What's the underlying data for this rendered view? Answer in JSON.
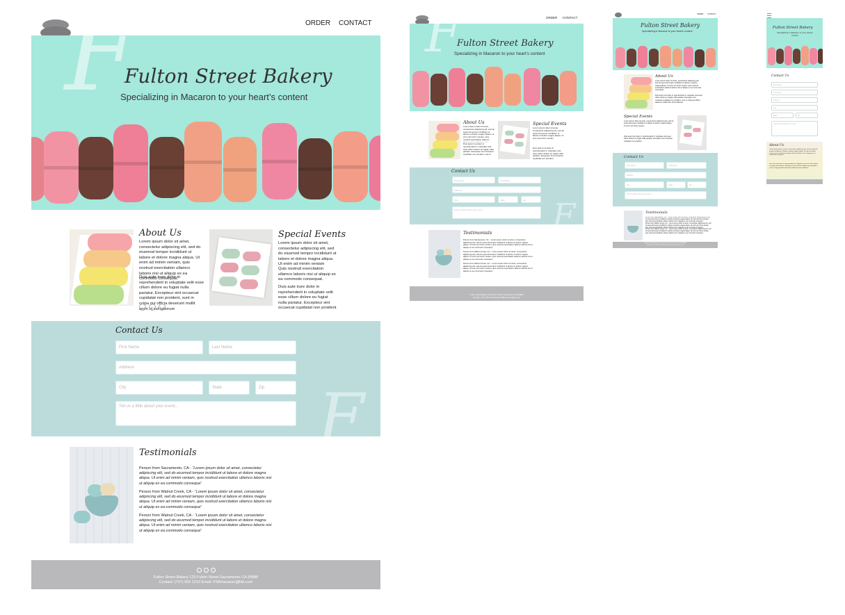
{
  "nav": {
    "order": "ORDER",
    "contact": "CONTACT"
  },
  "hero": {
    "title": "Fulton Street Bakery",
    "subtitle": "Specializing in Macaron to your heart’s content",
    "watermark": "F"
  },
  "about": {
    "heading": "About Us",
    "p1": "Lorem ipsum dolor sit amet, consectetur adipiscing elit, sed do eiusmod tempor incididunt ut labore et dolore magna aliqua. Ut enim ad minim veniam, quis nostrud exercitation ullamco laboris nisi ut aliquip ex ea commodo consequat.",
    "p2": "Duis aute irure dolor in reprehenderit in voluptate velit esse cillum dolore eu fugiat nulla pariatur. Excepteur sint occaecat cupidatat non proident, sunt in culpa qui officia deserunt mollit anim id est laborum"
  },
  "events": {
    "heading": "Special Events",
    "p1": "Lorem ipsum dolor sit amet, consectetur adipiscing elit, sed do eiusmod tempor incididunt ut labore et dolore magna aliqua. Ut enim ad minim veniam",
    "p2": "Quis nostrud exercitation ullamco laboris nisi ut aliquip ex ea commodo consequat.",
    "p3": "Duis aute irure dolor in reprehenderit in voluptate velit esse cillum dolore eu fugiat nulla pariatur. Excepteur sint occaecat cupidatat non proident"
  },
  "social": [
    "twitter-icon",
    "facebook-icon",
    "instagram-icon"
  ],
  "contact": {
    "heading": "Contact Us",
    "placeholders": {
      "first_name": "First Name",
      "last_name": "Last Name",
      "address": "Address",
      "city": "City",
      "state": "State",
      "zip": "Zip",
      "message": "Tell us a little about your event..."
    }
  },
  "testimonials": {
    "heading": "Testimonials",
    "items": [
      {
        "author": "Person  from Sacramento, CA - ",
        "quote": "“Lorem ipsum dolor sit amet, consectetur adipiscing elit, sed do eiusmod tempor incididunt ut labore et dolore magna aliqua. Ut enim ad minim veniam, quis nostrud exercitation ullamco laboris nisi ut aliquip ex ea commodo consequa”"
      },
      {
        "author": "Person  from Walnut Creek, CA - ",
        "quote": "“Lorem ipsum dolor sit amet, consectetur adipiscing elit, sed do eiusmod tempor incididunt ut labore et dolore magna aliqua. Ut enim ad minim veniam, quis nostrud exercitation ullamco laboris nisi ut aliquip ex ea commodo consequa”"
      },
      {
        "author": "Person  from Walnut Creek, CA - ",
        "quote": "“Lorem ipsum dolor sit amet, consectetur adipiscing elit, sed do eiusmod tempor incididunt ut labore et dolore magna aliqua. Ut enim ad minim veniam, quis nostrud exercitation ullamco laboris nisi ut aliquip ex ea commodo consequa”"
      }
    ]
  },
  "footer": {
    "line1": "Fulton Street Bakery  123 Fulton Street Sacramento CA 95886",
    "line2": "Contact: (707) 555 1213  Email: FSBmacaron@fsb.com"
  },
  "colors": {
    "hero_teal": "#a5e8dc",
    "contact_teal": "#bbdcdb",
    "footer_gray": "#b9b9bb",
    "logo_gray": "#7c7c7e"
  }
}
